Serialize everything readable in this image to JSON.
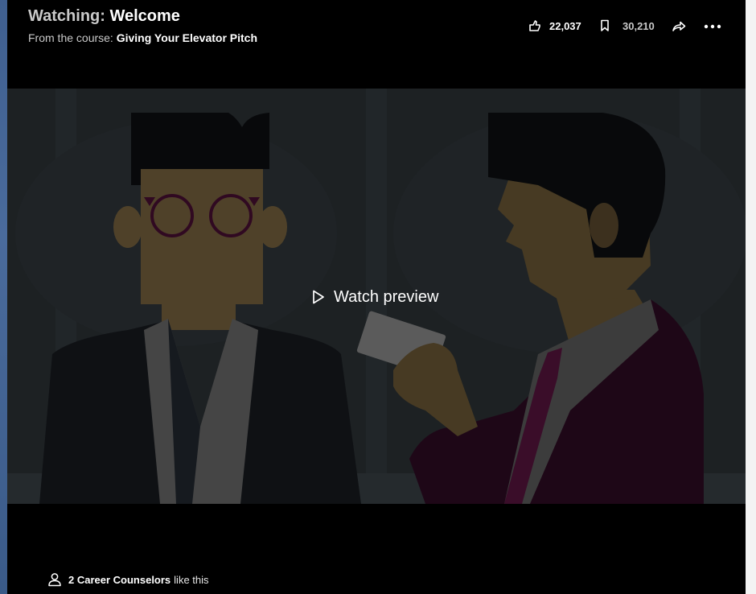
{
  "header": {
    "watching_prefix": "Watching:",
    "video_title": "Welcome",
    "course_prefix": "From the course:",
    "course_title": "Giving Your Elevator Pitch"
  },
  "actions": {
    "likes_count": "22,037",
    "saves_count": "30,210",
    "icons": [
      "thumbs-up-icon",
      "bookmark-icon",
      "share-icon",
      "more-icon"
    ]
  },
  "video": {
    "preview_label": "Watch preview"
  },
  "social": {
    "liked_by": "2 Career Counselors",
    "liked_suffix": "like this"
  },
  "colors": {
    "panel_background": "#000000",
    "video_background": "#2c3236",
    "suit_purple": "#3d0f2e",
    "tie_magenta": "#6b1848",
    "skin_tone": "#8b7246"
  }
}
